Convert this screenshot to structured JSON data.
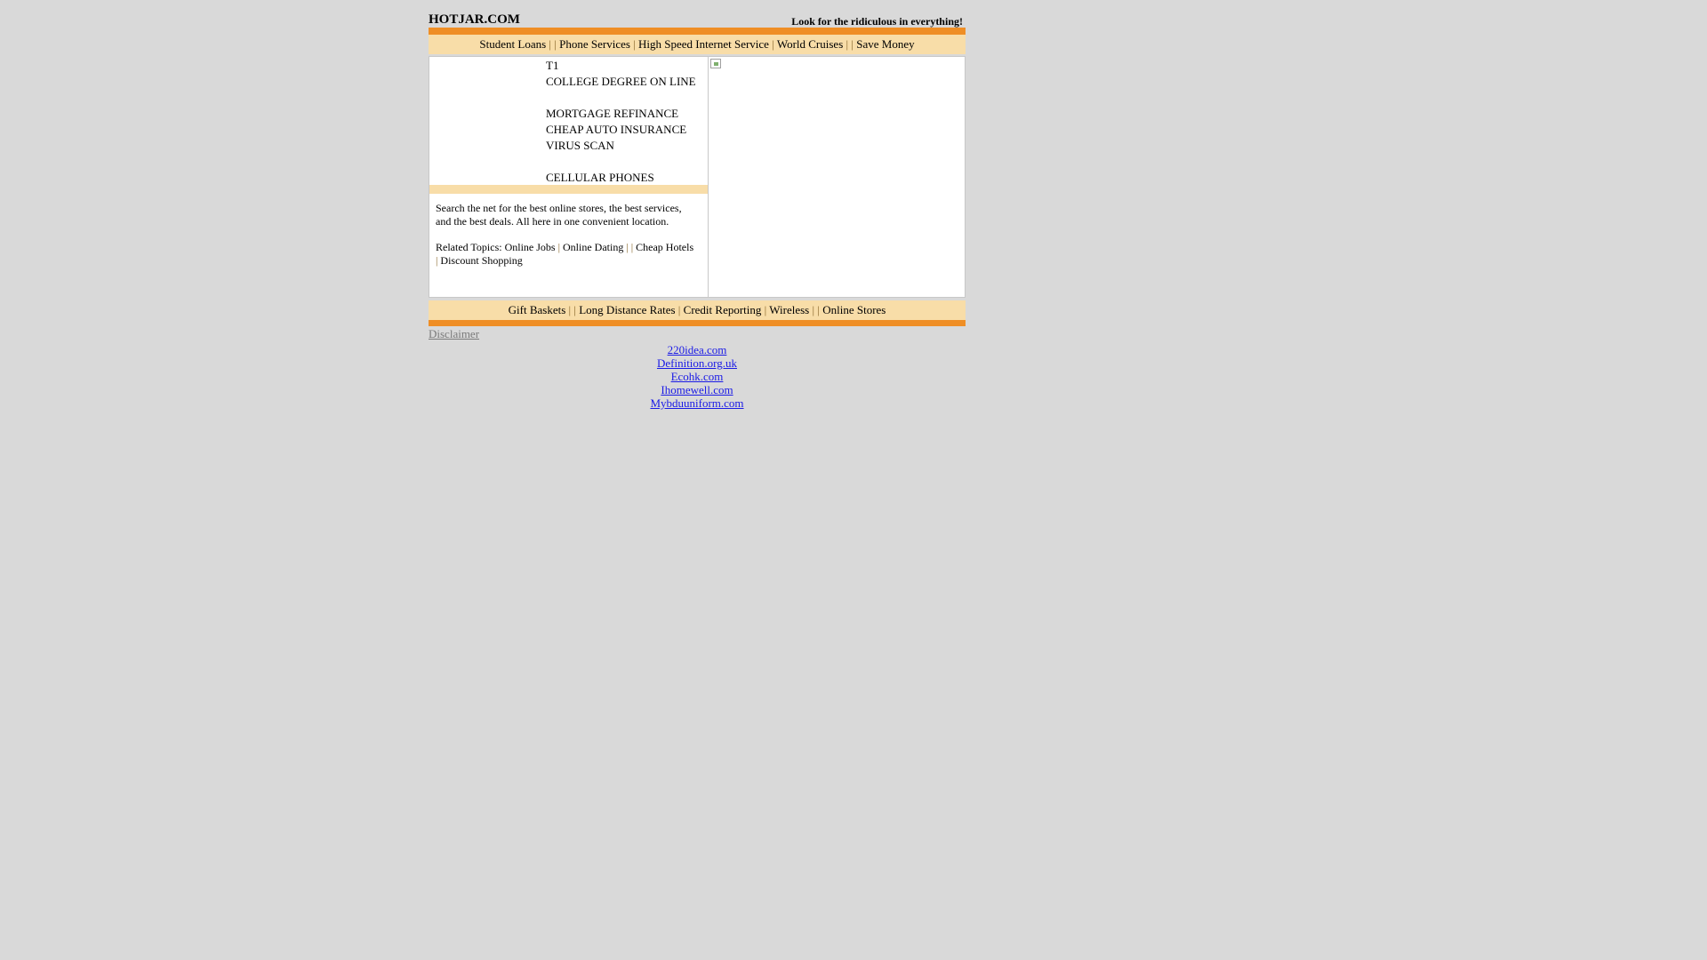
{
  "header": {
    "brand": "HOTJAR.COM",
    "tagline": "Look for the ridiculous in everything!"
  },
  "top_nav": {
    "items": [
      "Student Loans",
      "Phone Services",
      "High Speed Internet Service",
      "World Cruises",
      "Save Money"
    ],
    "separators": [
      "| |",
      "|",
      "|",
      "| |"
    ]
  },
  "keywords": [
    "T1",
    "COLLEGE DEGREE ON LINE",
    "",
    "MORTGAGE REFINANCE",
    "CHEAP AUTO INSURANCE",
    "VIRUS SCAN",
    "",
    "CELLULAR PHONES"
  ],
  "description": {
    "text": "Search the net for the best online stores, the best services, and the best deals. All here in one convenient location.",
    "related_label": "Related Topics:",
    "related_items": [
      "Online Jobs",
      "Online Dating",
      "Cheap Hotels",
      "Discount Shopping"
    ],
    "related_separators": [
      "|",
      "| |",
      "|"
    ]
  },
  "bottom_nav": {
    "items": [
      "Gift Baskets",
      "Long Distance Rates",
      "Credit Reporting",
      "Wireless",
      "Online Stores"
    ],
    "separators": [
      "| |",
      "|",
      "|",
      "| |"
    ]
  },
  "disclaimer": "Disclaimer",
  "footer_links": [
    "220idea.com",
    "Definition.org.uk",
    "Ecohk.com",
    "Ihomewell.com",
    "Mybduuniform.com"
  ],
  "colors": {
    "page_bg": "#d9d9d9",
    "orange_bar": "#ef8e25",
    "nav_bg": "#f8dda8",
    "link": "#1a1ae6"
  }
}
